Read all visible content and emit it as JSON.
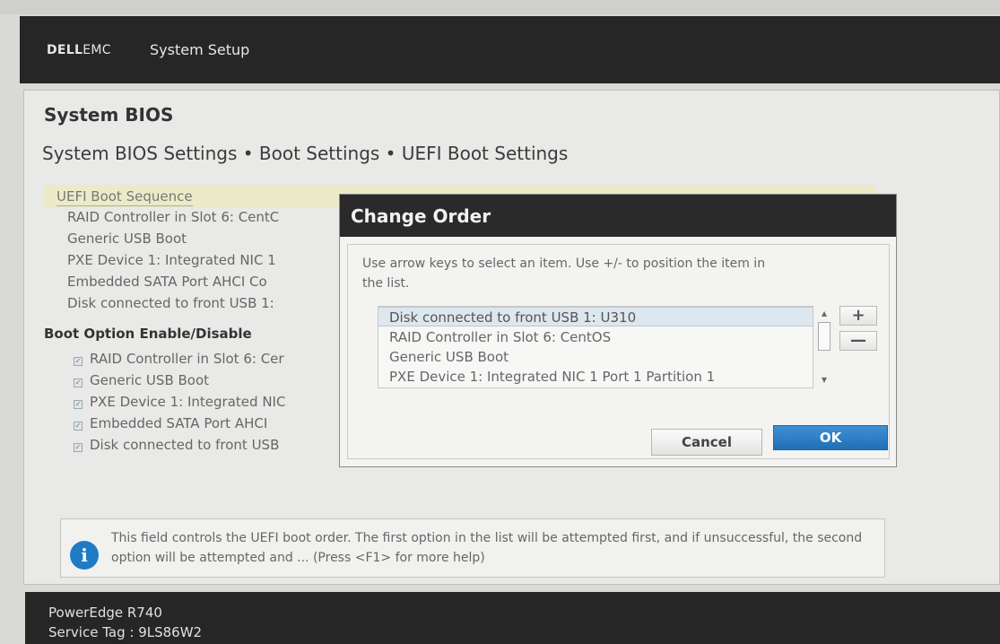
{
  "header": {
    "brand_dell": "DELL",
    "brand_emc": "EMC",
    "title": "System Setup"
  },
  "panel": {
    "title": "System BIOS",
    "breadcrumb": "System BIOS Settings • Boot Settings • UEFI Boot Settings"
  },
  "boot_sequence": {
    "label": "UEFI Boot Sequence",
    "items": [
      "RAID Controller in Slot 6: CentC",
      "Generic USB Boot",
      "PXE Device 1: Integrated NIC 1",
      "Embedded SATA Port AHCI Co",
      "Disk connected to front USB 1: "
    ]
  },
  "boot_options": {
    "label": "Boot Option Enable/Disable",
    "items": [
      {
        "label": "RAID Controller in Slot 6: Cer",
        "checked": true
      },
      {
        "label": "Generic USB Boot",
        "checked": true
      },
      {
        "label": "PXE Device 1: Integrated NIC",
        "checked": true
      },
      {
        "label": "Embedded SATA Port AHCI",
        "checked": true
      },
      {
        "label": "Disk connected to front USB",
        "checked": true
      }
    ]
  },
  "help": {
    "icon": "info-icon",
    "text": "This field controls the UEFI boot order. The first option in the list will be attempted first, and if unsuccessful, the second option will be attempted and ... (Press <F1> for more help)"
  },
  "footer": {
    "model": "PowerEdge R740",
    "service_tag": "Service Tag : 9LS86W2"
  },
  "dialog": {
    "title": "Change Order",
    "instruction": "Use arrow keys to select an item. Use +/- to position the item in the list.",
    "list_items": [
      "Disk connected to front USB 1: U310",
      "RAID Controller in Slot 6: CentOS",
      "Generic USB Boot",
      "PXE Device 1: Integrated NIC 1 Port 1 Partition 1"
    ],
    "selected_index": 0,
    "plus_label": "+",
    "minus_label": "—",
    "cancel_label": "Cancel",
    "ok_label": "OK"
  },
  "colors": {
    "header_bg": "#262626",
    "selected_row": "#dde7ef",
    "ok_button": "#1f6fb5",
    "info_icon": "#1f7bc6",
    "highlight_row": "#ecebc9"
  }
}
